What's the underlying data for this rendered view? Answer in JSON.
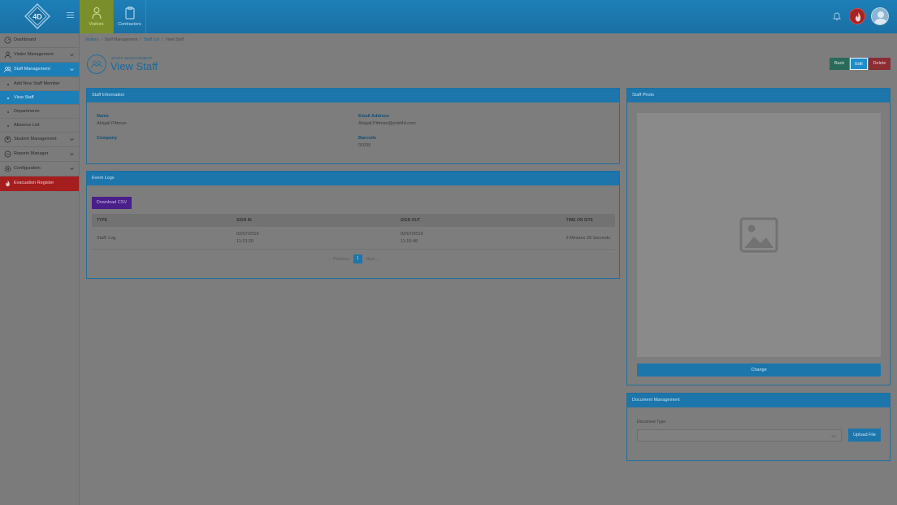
{
  "topbar": {
    "logo_text": "4D",
    "tabs": [
      {
        "label": "Visitors",
        "icon": "visitor-icon"
      },
      {
        "label": "Contractors",
        "icon": "clipboard-icon"
      }
    ]
  },
  "sidebar": {
    "items": [
      {
        "label": "Dashboard",
        "icon": "dashboard-icon"
      },
      {
        "label": "Visitor Management",
        "icon": "person-icon"
      },
      {
        "label": "Staff Management",
        "icon": "staff-icon"
      },
      {
        "label": "Add New Staff Member"
      },
      {
        "label": "View Staff"
      },
      {
        "label": "Departments"
      },
      {
        "label": "Absence List"
      },
      {
        "label": "Student Management",
        "icon": "student-icon"
      },
      {
        "label": "Reports Manager",
        "icon": "reports-icon"
      },
      {
        "label": "Configuration",
        "icon": "gear-icon"
      },
      {
        "label": "Evacuation Register",
        "icon": "fire-icon"
      }
    ]
  },
  "breadcrumb": [
    "Visitors",
    "Staff Management",
    "Staff List",
    "View Staff"
  ],
  "page": {
    "pretitle": "STAFF MANAGEMENT",
    "title": "View Staff",
    "back_label": "Back",
    "edit_label": "Edit",
    "delete_label": "Delete"
  },
  "staff_info": {
    "heading": "Staff Information",
    "name_label": "Name",
    "name_value": "Abigail Pittman",
    "email_label": "Email Address",
    "email_value": "Abigail.Pittman@pobl4d.com",
    "company_label": "Company",
    "barcode_label": "Barcode",
    "barcode_value": "01035"
  },
  "event_logs": {
    "heading": "Event Logs",
    "download_label": "Download CSV",
    "columns": [
      "TYPE",
      "SIGN IN",
      "SIGN OUT",
      "TIME ON SITE"
    ],
    "rows": [
      {
        "type": "Staff: Log",
        "sign_in_date": "02/07/2019",
        "sign_in_time": "11:13:20",
        "sign_out_date": "02/07/2019",
        "sign_out_time": "11:15:48",
        "time_on_site": "2 Minutes 28 Seconds"
      }
    ],
    "pager": {
      "prev": "← Previous",
      "page": "1",
      "next": "Next →"
    }
  },
  "staff_photo": {
    "heading": "Staff Photo",
    "change_label": "Change"
  },
  "documents": {
    "heading": "Document Management",
    "type_label": "Document Type:",
    "selected": "",
    "upload_label": "Upload File"
  }
}
